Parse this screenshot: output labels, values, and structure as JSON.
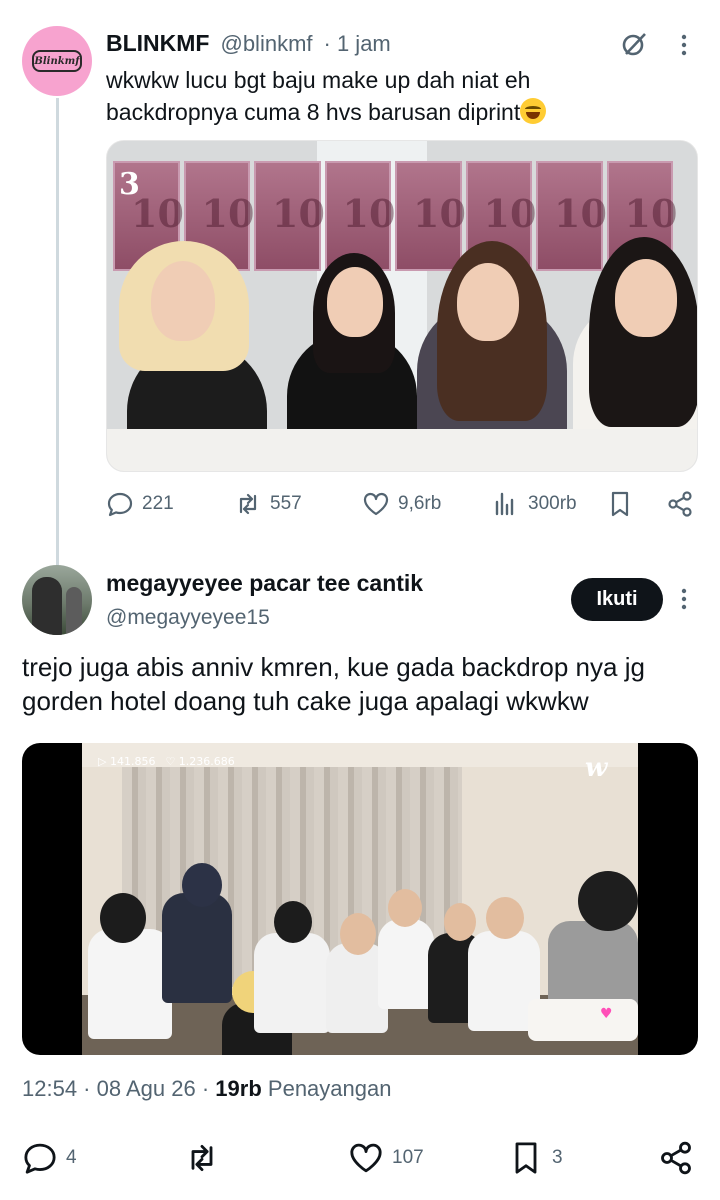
{
  "parent_tweet": {
    "name": "BLINKMF",
    "handle": "@blinkmf",
    "time": "· 1 jam",
    "avatar_logo_text": "Blinkmf",
    "text": "wkwkw lucu bgt baju make up dah niat eh backdropnya cuma 8 hvs barusan diprint",
    "emoji": "rolling-on-floor-laughing-emoji",
    "media_watermark": "3",
    "stats": {
      "replies": "221",
      "reposts": "557",
      "likes": "9,6rb",
      "views": "300rb"
    }
  },
  "main_tweet": {
    "name": "megayyeyee pacar tee cantik",
    "handle": "@megayyeyee15",
    "follow_label": "Ikuti",
    "text": "trejo juga abis anniv kmren, kue gada backdrop nya jg gorden hotel doang tuh cake juga apalagi wkwkw",
    "media": {
      "views_overlay": "▷ 141.856",
      "likes_overlay": "♡ 1.236.686",
      "watermark": "w"
    },
    "timestamp": {
      "time": "12:54",
      "date": "08 Agu 26",
      "views": "19rb",
      "views_label": "Penayangan"
    },
    "stats": {
      "replies": "4",
      "reposts": "",
      "likes": "107",
      "bookmarks": "3"
    }
  },
  "colors": {
    "text_primary": "#0f1419",
    "text_secondary": "#536471",
    "thread_line": "#cfd9de",
    "follow_bg": "#0f1419",
    "avatar_pink": "#f7a3cf"
  }
}
